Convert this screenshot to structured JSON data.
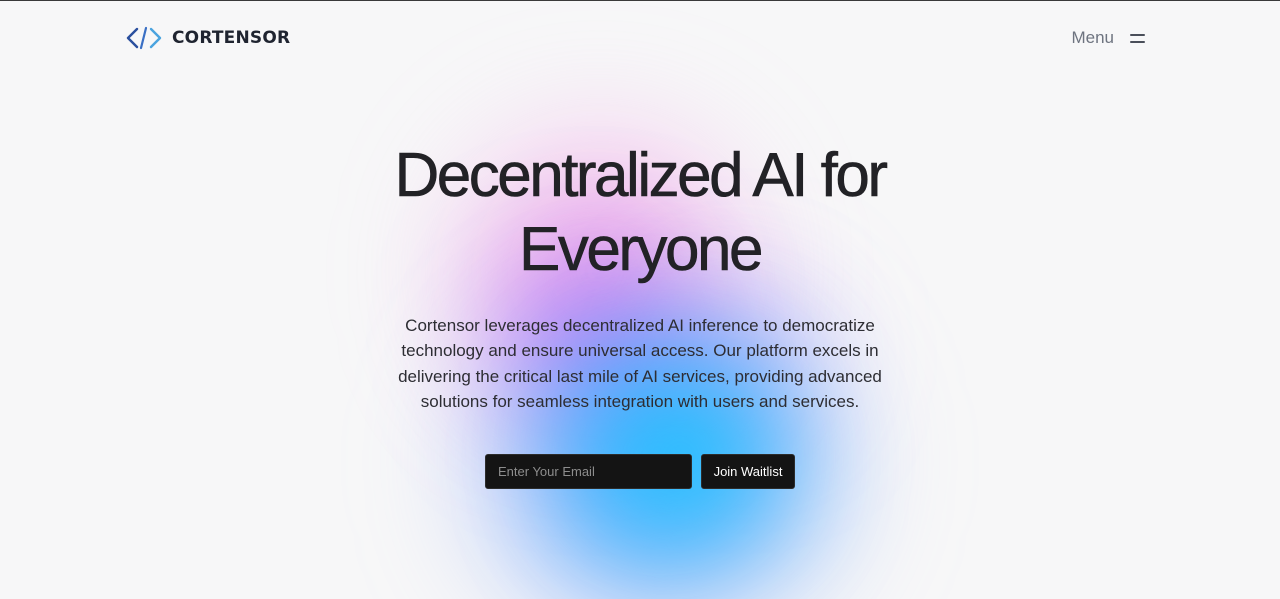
{
  "brand": {
    "name": "CORTENSOR",
    "logo_icon": "code-brackets-icon",
    "colors": {
      "logo_dark": "#2a4f9e",
      "logo_light": "#4aa3df"
    }
  },
  "nav": {
    "menu_label": "Menu",
    "menu_icon": "hamburger-icon"
  },
  "hero": {
    "title": "Decentralized AI for Everyone",
    "description": "Cortensor leverages decentralized AI inference to democratize technology and ensure universal access. Our platform excels in delivering the critical last mile of AI services, providing advanced solutions for seamless integration with users and services.",
    "email_placeholder": "Enter Your Email",
    "email_value": "",
    "cta_label": "Join Waitlist"
  },
  "colors": {
    "background": "#f7f7f8",
    "button": "#141414",
    "gradient": [
      "#f078dc",
      "#aa46ff",
      "#28aaff",
      "#00dcff"
    ]
  }
}
